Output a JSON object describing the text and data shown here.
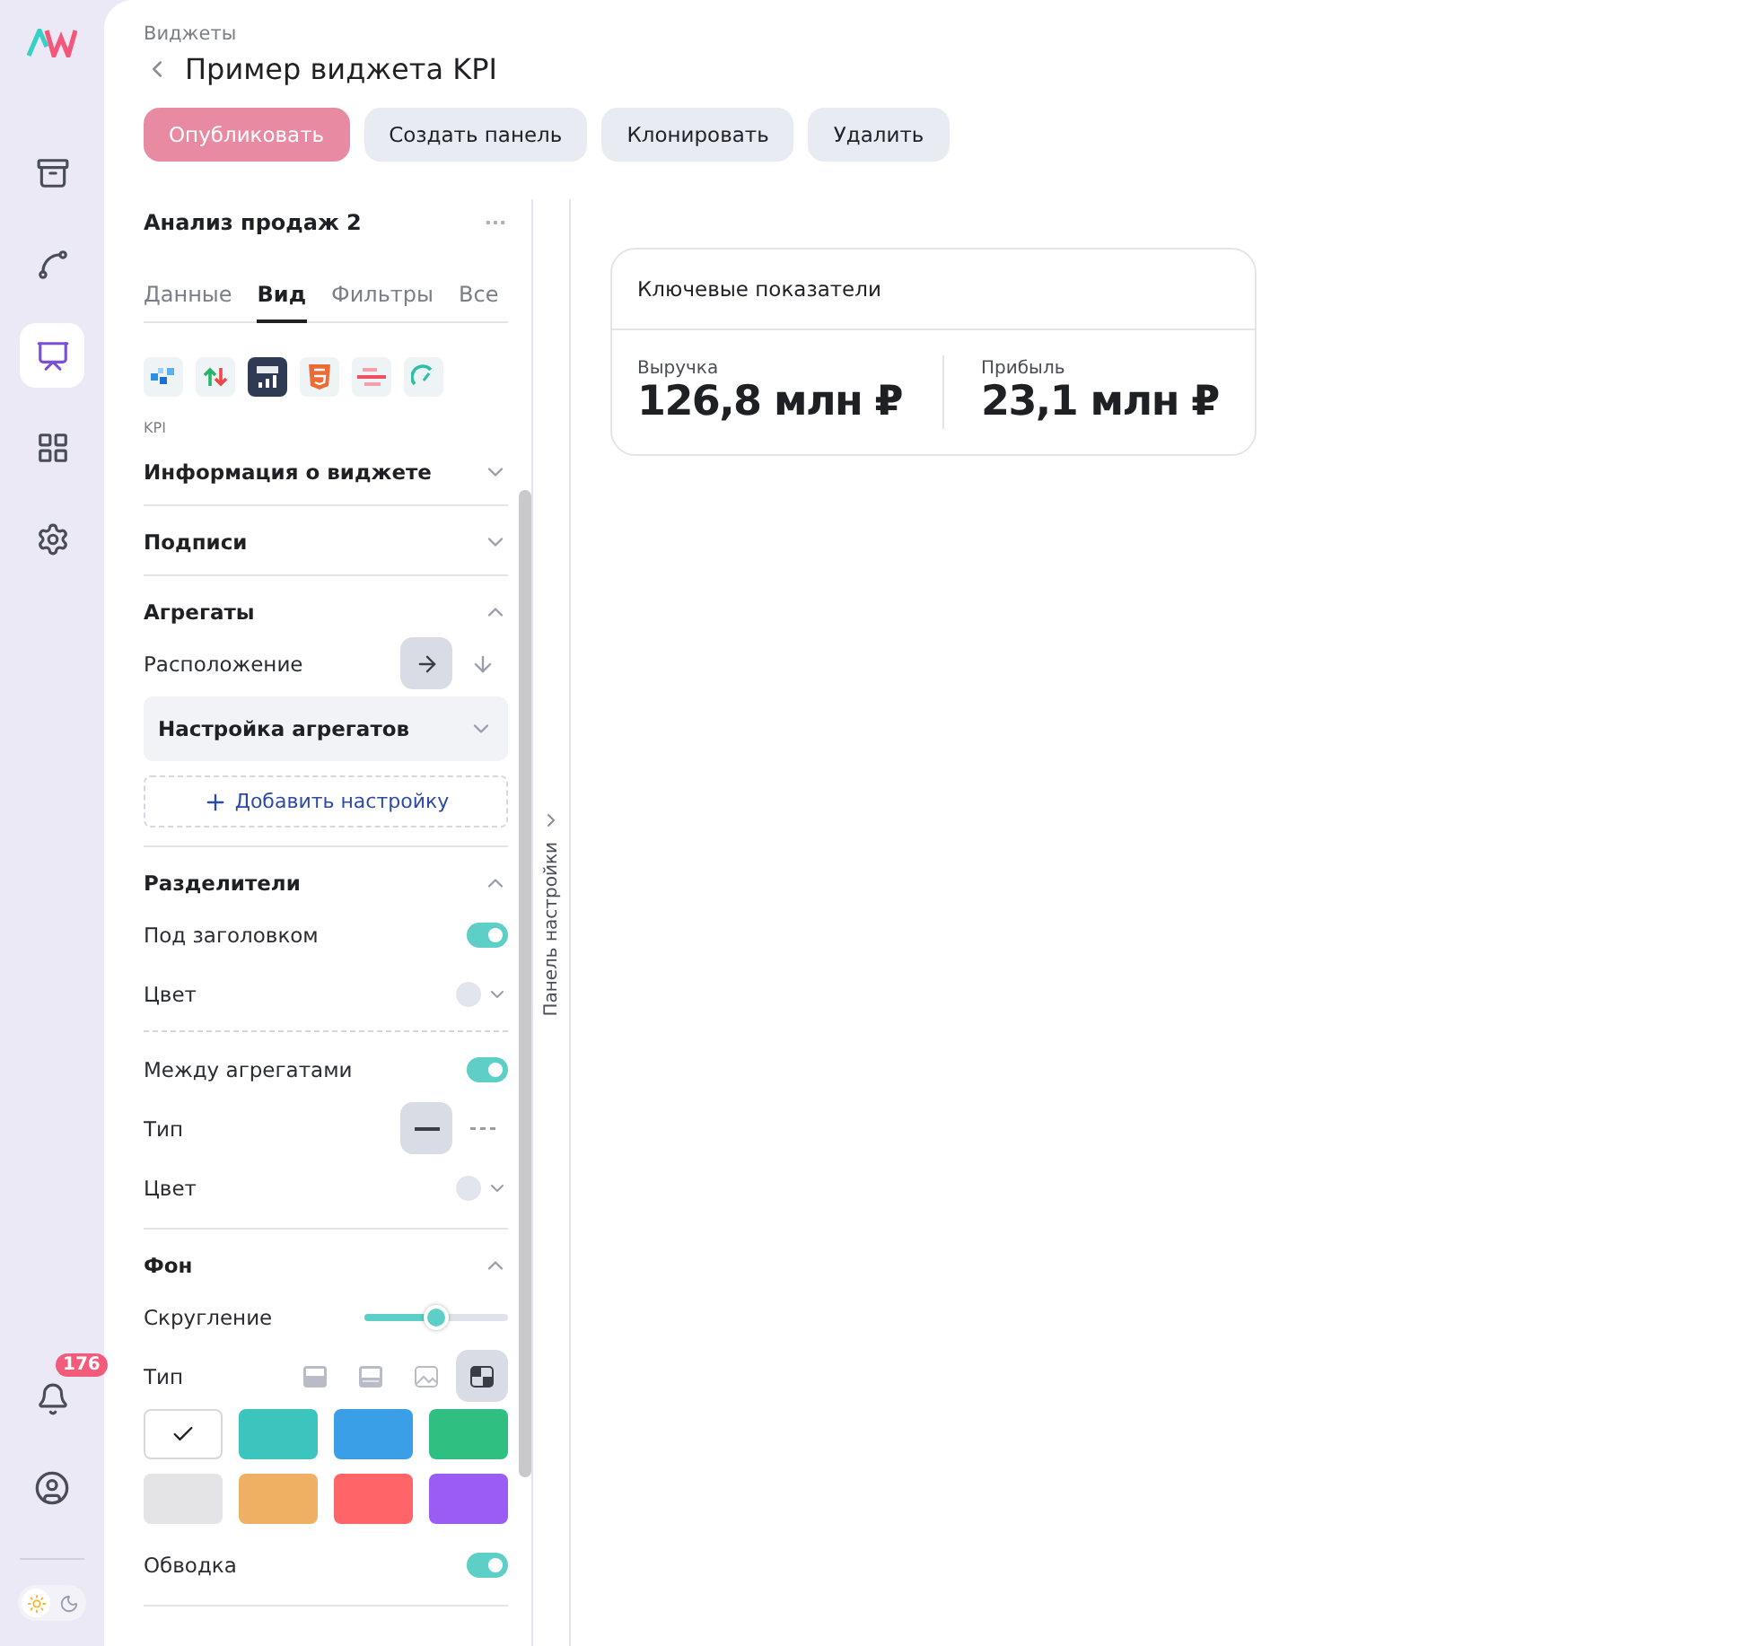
{
  "rail": {
    "items": [
      {
        "kind": "archive",
        "selected": false
      },
      {
        "kind": "graph",
        "selected": false
      },
      {
        "kind": "board",
        "selected": true
      },
      {
        "kind": "apps",
        "selected": false
      },
      {
        "kind": "settings",
        "selected": false
      }
    ],
    "notifications": {
      "badge": "176"
    },
    "theme_options": [
      {
        "kind": "sun",
        "selected": true
      },
      {
        "kind": "moon",
        "selected": false
      }
    ]
  },
  "breadcrumb": "Виджеты",
  "title": "Пример виджета KPI",
  "actions": [
    {
      "label": "Опубликовать",
      "disabled": true
    },
    {
      "label": "Создать панель",
      "disabled": false
    },
    {
      "label": "Клонировать",
      "disabled": false
    },
    {
      "label": "Удалить",
      "disabled": false
    }
  ],
  "panel": {
    "name": "Анализ продаж 2",
    "tabs": [
      {
        "label": "Данные",
        "selected": false
      },
      {
        "label": "Вид",
        "selected": true
      },
      {
        "label": "Фильтры",
        "selected": false
      },
      {
        "label": "Все",
        "selected": false
      }
    ],
    "widget_types": [
      {
        "kind": "heatmap",
        "selected": false
      },
      {
        "kind": "updown",
        "selected": false
      },
      {
        "kind": "kpi",
        "selected": true
      },
      {
        "kind": "html",
        "selected": false
      },
      {
        "kind": "gantt",
        "selected": false
      },
      {
        "kind": "gauge",
        "selected": false
      }
    ],
    "widget_type_label": "KPI",
    "sections": [
      {
        "title": "Информация о виджете",
        "expanded": false
      },
      {
        "title": "Подписи",
        "expanded": false
      },
      {
        "title": "Агрегаты",
        "expanded": true,
        "rows": [
          {
            "kind": "choice",
            "label": "Расположение",
            "options": [
              {
                "kind": "right",
                "selected": true
              },
              {
                "kind": "down",
                "selected": false
              }
            ]
          },
          {
            "kind": "subsection",
            "label": "Настройка агрегатов",
            "expanded": false
          },
          {
            "kind": "add",
            "label": "Добавить настройку"
          }
        ]
      },
      {
        "title": "Разделители",
        "expanded": true,
        "rows": [
          {
            "kind": "toggle",
            "label": "Под заголовком",
            "on": true
          },
          {
            "kind": "color",
            "label": "Цвет"
          },
          {
            "kind": "divider"
          },
          {
            "kind": "toggle",
            "label": "Между агрегатами",
            "on": true
          },
          {
            "kind": "choice",
            "label": "Тип",
            "options": [
              {
                "kind": "solid",
                "selected": true
              },
              {
                "kind": "dashed",
                "selected": false
              }
            ]
          },
          {
            "kind": "color",
            "label": "Цвет"
          }
        ]
      },
      {
        "title": "Фон",
        "expanded": true,
        "rows": [
          {
            "kind": "slider",
            "label": "Скругление",
            "level": 0.5
          },
          {
            "kind": "choice",
            "label": "Тип",
            "options": [
              {
                "kind": "fill",
                "selected": false
              },
              {
                "kind": "gradient",
                "selected": false
              },
              {
                "kind": "image",
                "selected": false
              },
              {
                "kind": "preset",
                "selected": true
              }
            ]
          },
          {
            "kind": "swatches",
            "swatches": [
              {
                "color": "#ffffff",
                "selected": true
              },
              {
                "color": "#3cc4bf",
                "selected": false
              },
              {
                "color": "#3a9fe6",
                "selected": false
              },
              {
                "color": "#2fbf80",
                "selected": false
              },
              {
                "color": "#e4e4e6",
                "selected": false
              },
              {
                "color": "#efb063",
                "selected": false
              },
              {
                "color": "#ff6468",
                "selected": false
              },
              {
                "color": "#9b5cf6",
                "selected": false
              }
            ]
          },
          {
            "kind": "toggle",
            "label": "Обводка",
            "on": true
          }
        ]
      }
    ]
  },
  "side_tab": "Панель настройки",
  "card": {
    "title": "Ключевые показатели",
    "metrics": [
      {
        "label": "Выручка",
        "value": "126,8 млн ₽"
      },
      {
        "label": "Прибыль",
        "value": "23,1 млн ₽"
      }
    ]
  }
}
